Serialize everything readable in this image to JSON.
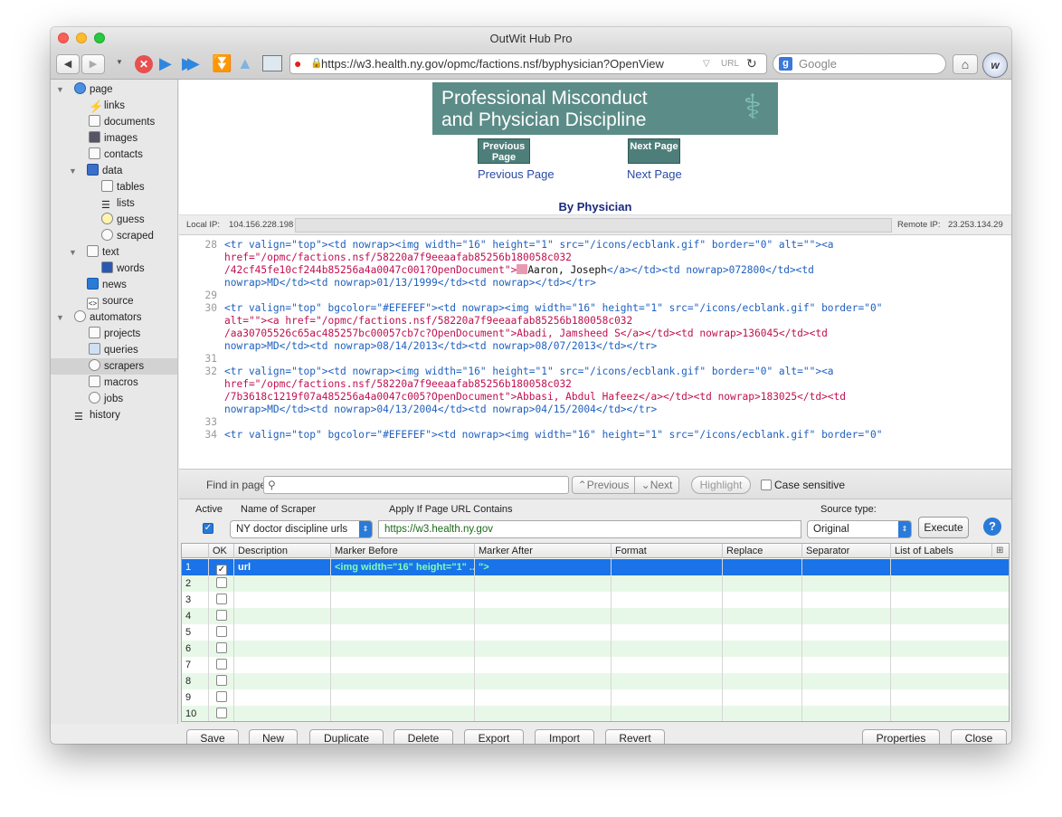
{
  "window": {
    "title": "OutWit Hub Pro"
  },
  "toolbar": {
    "url": "https://w3.health.ny.gov/opmc/factions.nsf/byphysician?OpenView",
    "url_tag": "URL",
    "search_placeholder": "Google"
  },
  "sidebar": {
    "items": [
      {
        "label": "page",
        "icon": "globe-icon"
      },
      {
        "label": "links",
        "icon": "lightning-icon"
      },
      {
        "label": "documents",
        "icon": "document-icon"
      },
      {
        "label": "images",
        "icon": "image-icon"
      },
      {
        "label": "contacts",
        "icon": "envelope-icon"
      },
      {
        "label": "data",
        "icon": "data-icon"
      },
      {
        "label": "tables",
        "icon": "table-icon"
      },
      {
        "label": "lists",
        "icon": "list-icon"
      },
      {
        "label": "guess",
        "icon": "bulb-icon"
      },
      {
        "label": "scraped",
        "icon": "gear-icon"
      },
      {
        "label": "text",
        "icon": "text-icon"
      },
      {
        "label": "words",
        "icon": "words-icon"
      },
      {
        "label": "news",
        "icon": "rss-icon"
      },
      {
        "label": "source",
        "icon": "code-icon"
      },
      {
        "label": "automators",
        "icon": "gears-icon"
      },
      {
        "label": "projects",
        "icon": "pencil-icon"
      },
      {
        "label": "queries",
        "icon": "folder-icon"
      },
      {
        "label": "scrapers",
        "icon": "gear-icon"
      },
      {
        "label": "macros",
        "icon": "macro-icon"
      },
      {
        "label": "jobs",
        "icon": "clock-icon"
      },
      {
        "label": "history",
        "icon": "history-icon"
      }
    ]
  },
  "web": {
    "banner_line1": "Professional Misconduct",
    "banner_line2": "and Physician Discipline",
    "prev_btn": "Previous Page",
    "next_btn": "Next Page",
    "prev_link": "Previous Page",
    "next_link": "Next Page",
    "heading": "By Physician"
  },
  "ipbar": {
    "local_label": "Local IP:",
    "local_ip": "104.156.228.198",
    "remote_label": "Remote IP:",
    "remote_ip": "23.253.134.29"
  },
  "source": {
    "line_28": "28",
    "l28a": "<tr valign=\"top\"><td nowrap><img width=\"16\" height=\"1\" src=\"/icons/ecblank.gif\" border=\"0\" alt=\"\"><a",
    "l28b": "href=\"/opmc/factions.nsf/58220a7f9eeaafab85256b180058c032",
    "l28c": "/42cf45fe10cf244b85256a4a0047c001?OpenDocument\">",
    "l28c_name": "Aaron, Joseph",
    "l28c_rest": "</a></td><td nowrap>072800</td><td",
    "l28d": "nowrap>MD</td><td nowrap>01/13/1999</td><td nowrap></td></tr>",
    "line_29": "29",
    "line_30": "30",
    "l30a": "<tr valign=\"top\" bgcolor=\"#EFEFEF\"><td nowrap><img width=\"16\" height=\"1\" src=\"/icons/ecblank.gif\" border=\"0\"",
    "l30b": "alt=\"\"><a href=\"/opmc/factions.nsf/58220a7f9eeaafab85256b180058c032",
    "l30c": "/aa30705526c65ac485257bc00057cb7c?OpenDocument\">Abadi, Jamsheed S</a></td><td nowrap>136045</td><td",
    "l30d": "nowrap>MD</td><td nowrap>08/14/2013</td><td nowrap>08/07/2013</td></tr>",
    "line_31": "31",
    "line_32": "32",
    "l32a": "<tr valign=\"top\"><td nowrap><img width=\"16\" height=\"1\" src=\"/icons/ecblank.gif\" border=\"0\" alt=\"\"><a",
    "l32b": "href=\"/opmc/factions.nsf/58220a7f9eeaafab85256b180058c032",
    "l32c": "/7b3618c1219f07a485256a4a0047c005?OpenDocument\">Abbasi, Abdul Hafeez</a></td><td nowrap>183025</td><td",
    "l32d": "nowrap>MD</td><td nowrap>04/13/2004</td><td nowrap>04/15/2004</td></tr>",
    "line_33": "33",
    "line_34": "34",
    "l34a": "<tr valign=\"top\" bgcolor=\"#EFEFEF\"><td nowrap><img width=\"16\" height=\"1\" src=\"/icons/ecblank.gif\" border=\"0\""
  },
  "find": {
    "label": "Find in page",
    "previous": "Previous",
    "next": "Next",
    "highlight": "Highlight",
    "case_sensitive": "Case sensitive"
  },
  "scraper": {
    "active_label": "Active",
    "name_label": "Name of Scraper",
    "apply_label": "Apply If Page URL Contains",
    "source_label": "Source type:",
    "name_value": "NY doctor discipline urls",
    "url_value": "https://w3.health.ny.gov",
    "source_value": "Original",
    "execute": "Execute"
  },
  "grid": {
    "headers": [
      "",
      "OK",
      "Description",
      "Marker Before",
      "Marker After",
      "Format",
      "Replace",
      "Separator",
      "List of Labels"
    ],
    "rows": [
      {
        "num": "1",
        "desc": "url",
        "before": "<img width=\"16\" height=\"1\" ...",
        "after": "\">"
      },
      {
        "num": "2",
        "desc": "",
        "before": "",
        "after": ""
      },
      {
        "num": "3",
        "desc": "",
        "before": "",
        "after": ""
      },
      {
        "num": "4",
        "desc": "",
        "before": "",
        "after": ""
      },
      {
        "num": "5",
        "desc": "",
        "before": "",
        "after": ""
      },
      {
        "num": "6",
        "desc": "",
        "before": "",
        "after": ""
      },
      {
        "num": "7",
        "desc": "",
        "before": "",
        "after": ""
      },
      {
        "num": "8",
        "desc": "",
        "before": "",
        "after": ""
      },
      {
        "num": "9",
        "desc": "",
        "before": "",
        "after": ""
      },
      {
        "num": "10",
        "desc": "",
        "before": "",
        "after": ""
      }
    ]
  },
  "buttons": {
    "save": "Save",
    "new": "New",
    "duplicate": "Duplicate",
    "delete": "Delete",
    "export": "Export",
    "import": "Import",
    "revert": "Revert",
    "properties": "Properties",
    "close": "Close"
  },
  "colors": {
    "selection": "#1a73e8",
    "banner": "#5b8c88",
    "row_alt": "#e8f8e8"
  }
}
